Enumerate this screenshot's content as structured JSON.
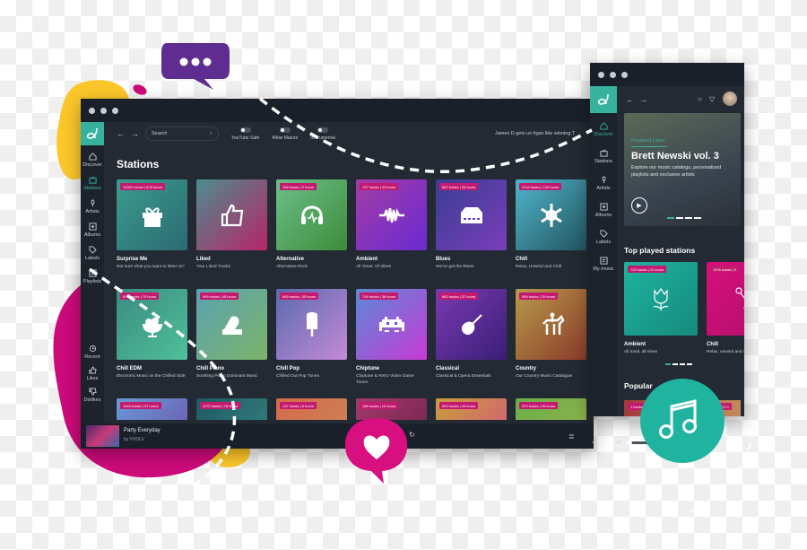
{
  "main_window": {
    "search_placeholder": "Search",
    "toggles": [
      {
        "label": "YouTube Safe",
        "on": false
      },
      {
        "label": "Allow Mature",
        "on": false
      },
      {
        "label": "Instrumental",
        "on": false
      }
    ],
    "ticker": "James D gets us hype like winning T",
    "title": "Stations",
    "sidebar": [
      {
        "label": "Discover",
        "icon": "home-icon",
        "active": false
      },
      {
        "label": "Stations",
        "icon": "radio-icon",
        "active": true
      },
      {
        "label": "Artists",
        "icon": "mic-icon",
        "active": false
      },
      {
        "label": "Albums",
        "icon": "album-icon",
        "active": false
      },
      {
        "label": "Labels",
        "icon": "tag-icon",
        "active": false
      },
      {
        "label": "Playlists",
        "icon": "playlist-icon",
        "active": false
      }
    ],
    "sidebar_bottom": [
      {
        "label": "Recent",
        "icon": "history-icon"
      },
      {
        "label": "Likes",
        "icon": "thumbs-up-icon"
      },
      {
        "label": "Dislikes",
        "icon": "thumbs-down-icon"
      }
    ],
    "stations": [
      {
        "name": "Surprise Me",
        "desc": "Not sure what you want to listen to?",
        "badge": "10002 tracks | 578 hours",
        "icon": "gift-icon",
        "c1": "#3a9c8c",
        "c2": "#2b6a73"
      },
      {
        "name": "Liked",
        "desc": "Your Liked Tracks",
        "badge": "",
        "icon": "thumbs-up-icon",
        "c1": "#4c8d8c",
        "c2": "#b8246a"
      },
      {
        "name": "Alternative",
        "desc": "Alternative Rock",
        "badge": "168 tracks | 9 hours",
        "icon": "headphones-icon",
        "c1": "#6cbf8a",
        "c2": "#3d8c3a"
      },
      {
        "name": "Ambient",
        "desc": "All Tonal, All Vibes",
        "badge": "757 tracks | 43 hours",
        "icon": "waveform-icon",
        "c1": "#a33da6",
        "c2": "#6a2ad0"
      },
      {
        "name": "Blues",
        "desc": "We've got the Blues",
        "badge": "567 tracks | 26 hours",
        "icon": "cassette-icon",
        "c1": "#3a3e92",
        "c2": "#7a3dbb"
      },
      {
        "name": "Chill",
        "desc": "Relax, Unwind and Chill",
        "badge": "2119 tracks | 103 hours",
        "icon": "snowflake-icon",
        "c1": "#4fb6cc",
        "c2": "#23535e"
      },
      {
        "name": "Chill EDM",
        "desc": "Electronic Music on the Chilled Side",
        "badge": "679 tracks | 79 hours",
        "icon": "sundae-icon",
        "c1": "#3a8c80",
        "c2": "#4fbf9a"
      },
      {
        "name": "Chill Piano",
        "desc": "Soothing Piano Dominant Music",
        "badge": "999 tracks | 45 hours",
        "icon": "piano-icon",
        "c1": "#5aa2b0",
        "c2": "#7cb46a"
      },
      {
        "name": "Chill Pop",
        "desc": "Chilled Out Pop Tunes",
        "badge": "665 tracks | 35 hours",
        "icon": "popsicle-icon",
        "c1": "#5a6ab0",
        "c2": "#c48ad6"
      },
      {
        "name": "Chiptune",
        "desc": "Chiptune & Retro Video Game Tunes",
        "badge": "746 tracks | 38 hours",
        "icon": "space-invader-icon",
        "c1": "#5a8ad6",
        "c2": "#c83ad6"
      },
      {
        "name": "Classical",
        "desc": "Classical & Opera Essentials",
        "badge": "662 tracks | 37 hours",
        "icon": "violin-icon",
        "c1": "#7a3ab0",
        "c2": "#3a1e78"
      },
      {
        "name": "Country",
        "desc": "Our Country Music Catalogue",
        "badge": "559 tracks | 29 hours",
        "icon": "horse-rider-icon",
        "c1": "#b89a4a",
        "c2": "#8a3a2a"
      },
      {
        "name": "",
        "desc": "",
        "badge": "1943 tracks | 97 hours",
        "icon": "",
        "c1": "#6a9ad6",
        "c2": "#6a4aa6"
      },
      {
        "name": "",
        "desc": "",
        "badge": "1175 tracks | 78 hours",
        "icon": "",
        "c1": "#1e5a60",
        "c2": "#3a8a8a"
      },
      {
        "name": "",
        "desc": "",
        "badge": "137 tracks | 6 hours",
        "icon": "",
        "c1": "#d66a4a",
        "c2": "#c88a5a"
      },
      {
        "name": "",
        "desc": "",
        "badge": "186 tracks | 10 hours",
        "icon": "",
        "c1": "#a33a6a",
        "c2": "#6a1e4a"
      },
      {
        "name": "",
        "desc": "",
        "badge": "693 tracks | 33 hours",
        "icon": "",
        "c1": "#c8a03a",
        "c2": "#d64a8a"
      },
      {
        "name": "",
        "desc": "",
        "badge": "572 tracks | 26 hours",
        "icon": "",
        "c1": "#6ab04a",
        "c2": "#9ab04a"
      }
    ],
    "player": {
      "track": "Party Everyday",
      "artist": "by VVDLV",
      "volume": 0.25
    }
  },
  "side_window": {
    "sidebar": [
      {
        "label": "Discover",
        "active": true
      },
      {
        "label": "Stations",
        "active": false
      },
      {
        "label": "Artists",
        "active": false
      },
      {
        "label": "Albums",
        "active": false
      },
      {
        "label": "Labels",
        "active": false
      },
      {
        "label": "My music",
        "active": false
      }
    ],
    "hero": {
      "kicker": "Featured Label",
      "title": "Brett Newski vol. 3",
      "desc": "Explore our music catalogs, personalized playlists and exclusive artists",
      "slides": 4,
      "active_slide": 1
    },
    "top_played_title": "Top played stations",
    "top_played": [
      {
        "name": "Ambient",
        "desc": "All tonal, all vibes",
        "badge": "729 tracks | 41 hours",
        "icon": "tulip-icon"
      },
      {
        "name": "Chill",
        "desc": "Relax, unwind and chill",
        "badge": "1976 tracks | 9",
        "icon": "dancer-icon"
      }
    ],
    "popular_title": "Popular",
    "popular_badges": [
      "1 tracks",
      "tracks | 21 h"
    ]
  },
  "colors": {
    "accent": "#37b29f",
    "badge": "#c4196f",
    "dark": "#232a33"
  }
}
